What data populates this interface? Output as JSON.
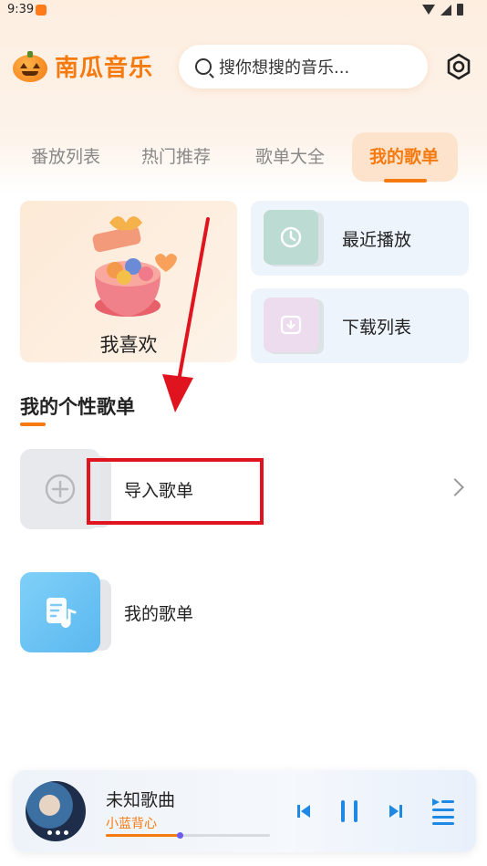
{
  "status_bar": {
    "time": "9:39"
  },
  "header": {
    "app_name": "南瓜音乐",
    "search_placeholder": "搜你想搜的音乐..."
  },
  "tabs": [
    {
      "label": "番放列表"
    },
    {
      "label": "热门推荐"
    },
    {
      "label": "歌单大全"
    },
    {
      "label": "我的歌单",
      "active": true
    }
  ],
  "quick_cards": {
    "favorites_label": "我喜欢",
    "recent_label": "最近播放",
    "download_label": "下载列表"
  },
  "section": {
    "title": "我的个性歌单"
  },
  "playlists": [
    {
      "label": "导入歌单"
    },
    {
      "label": "我的歌单"
    }
  ],
  "player": {
    "song_title": "未知歌曲",
    "artist": "小蓝背心",
    "progress": 0.45
  },
  "colors": {
    "accent": "#f57a0f",
    "highlight": "#e0141e"
  }
}
